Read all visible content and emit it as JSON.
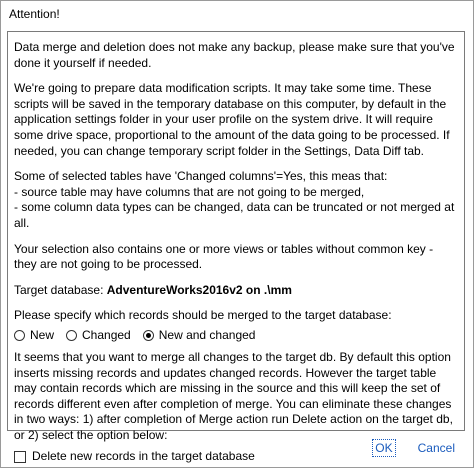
{
  "window": {
    "title": "Attention!"
  },
  "body": {
    "p1": "Data merge and deletion does not make any backup, please make sure that you've done it yourself if needed.",
    "p2": "We're going to prepare data modification scripts. It may take some time. These scripts will be saved in the temporary database on this computer, by default in the application settings folder in your user profile on the system drive. It will require some drive space, proportional to the amount of the data going to be processed. If needed, you can change temporary script folder in the Settings, Data Diff tab.",
    "p3_lines": [
      "Some of selected tables have 'Changed columns'=Yes, this meas that:",
      "- source table may have columns that are not going to be merged,",
      "- some column data types can be changed, data can be truncated or not merged at all."
    ],
    "p4": "Your selection also contains one or more views or tables without common key - they are not going to be processed.",
    "target_label": "Target database: ",
    "target_value": "AdventureWorks2016v2 on .\\mm",
    "records_question": "Please specify which records should be merged to the target database:",
    "radio_options": [
      {
        "label": "New",
        "checked": false
      },
      {
        "label": "Changed",
        "checked": false
      },
      {
        "label": "New and changed",
        "checked": true
      }
    ],
    "p5": "It seems that you want to merge all changes to the target db. By default this option inserts missing records and updates changed records. However the target table may contain records which are missing in the source and this will keep the set of records different even after completion of merge. You can eliminate these changes in two ways: 1) after completion of Merge action run Delete action on the target db, or 2) select the option below:",
    "delete_checkbox_label": "Delete new records in the target database",
    "delete_checked": false
  },
  "buttons": {
    "ok": "OK",
    "cancel": "Cancel"
  },
  "colors": {
    "button_text": "#1a5bbd",
    "border": "#7a7a7a"
  }
}
